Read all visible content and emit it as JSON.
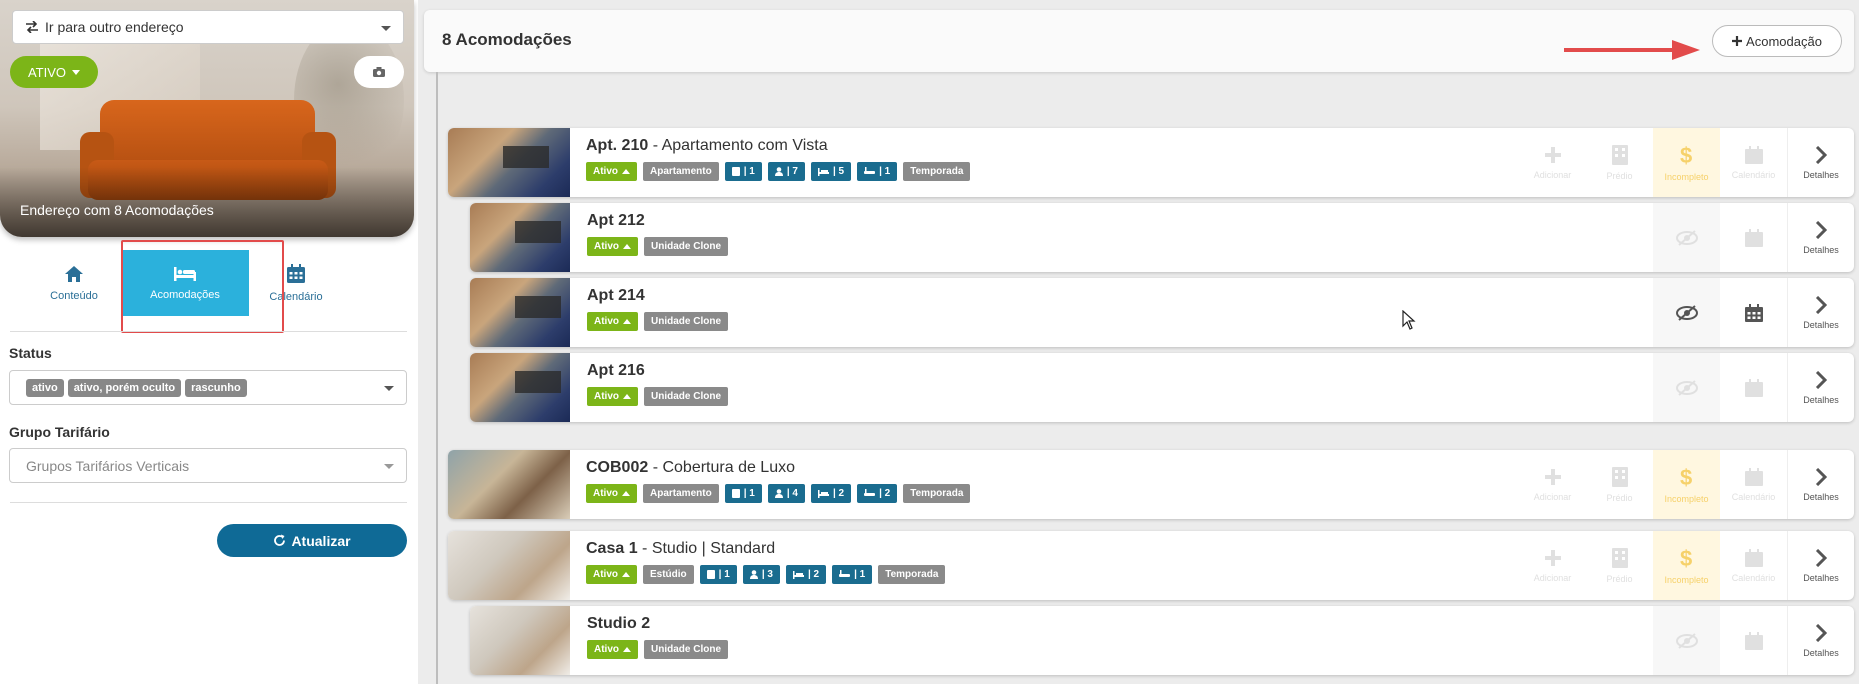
{
  "sidebar": {
    "address_select": "Ir para outro endereço",
    "status_button": "ATIVO",
    "hero_caption": "Endereço com 8 Acomodações",
    "tabs": [
      {
        "label": "Conteúdo",
        "icon": "home-icon"
      },
      {
        "label": "Acomodações",
        "icon": "bed-icon",
        "active": true
      },
      {
        "label": "Calendário",
        "icon": "calendar-icon"
      }
    ],
    "status_label": "Status",
    "status_chips": [
      "ativo",
      "ativo, porém oculto",
      "rascunho"
    ],
    "grupo_label": "Grupo Tarifário",
    "grupo_placeholder": "Grupos Tarifários Verticais",
    "update_button": "Atualizar"
  },
  "main": {
    "title": "8 Acomodações",
    "add_button": "Acomodação",
    "accent": "#e24b4b"
  },
  "rows": [
    {
      "code": "Apt. 210",
      "name": " - Apartamento com Vista",
      "status": "Ativo",
      "type": "Apartamento",
      "counts": [
        "| 1",
        "| 7",
        "| 5",
        "| 1"
      ],
      "rental": "Temporada"
    },
    {
      "code": "Apt 212",
      "status": "Ativo",
      "clone": "Unidade Clone"
    },
    {
      "code": "Apt 214",
      "status": "Ativo",
      "clone": "Unidade Clone"
    },
    {
      "code": "Apt 216",
      "status": "Ativo",
      "clone": "Unidade Clone"
    },
    {
      "code": "COB002",
      "name": " - Cobertura de Luxo",
      "status": "Ativo",
      "type": "Apartamento",
      "counts": [
        "| 1",
        "| 4",
        "| 2",
        "| 2"
      ],
      "rental": "Temporada"
    },
    {
      "code": "Casa 1",
      "name": " - Studio | Standard",
      "status": "Ativo",
      "type": "Estúdio",
      "counts": [
        "| 1",
        "| 3",
        "| 2",
        "| 1"
      ],
      "rental": "Temporada"
    },
    {
      "code": "Studio 2",
      "status": "Ativo",
      "clone": "Unidade Clone"
    }
  ],
  "actions": {
    "add": "Adicionar",
    "building": "Prédio",
    "incomplete": "Incompleto",
    "calendar": "Calendário",
    "details": "Detalhes"
  }
}
